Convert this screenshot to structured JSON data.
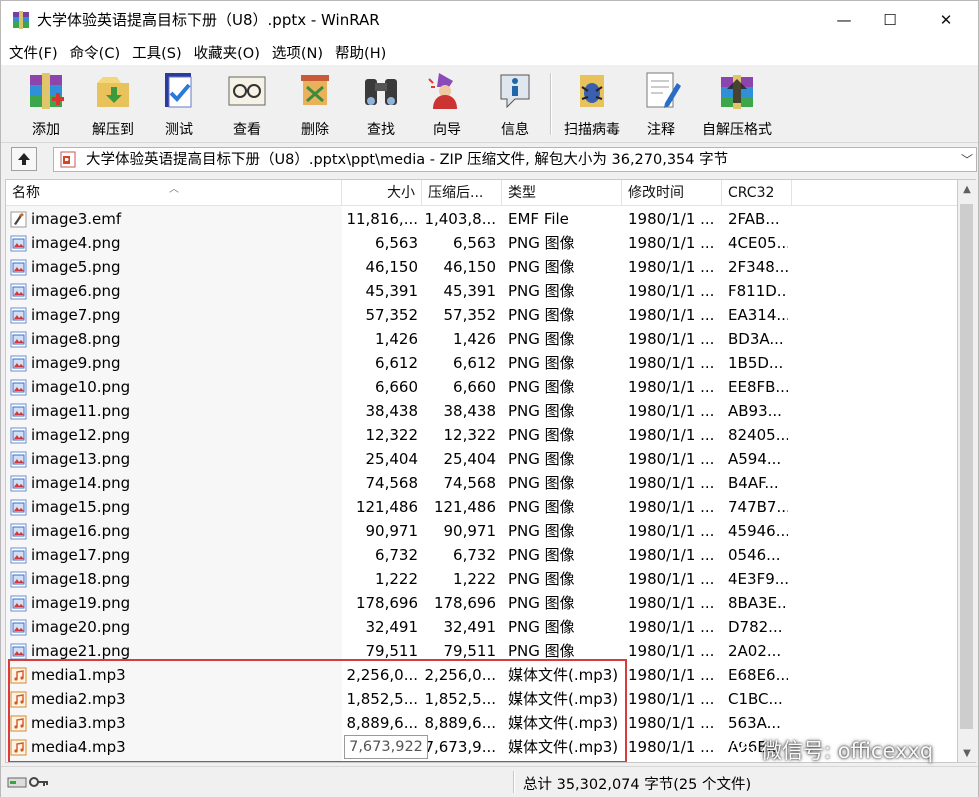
{
  "window": {
    "title": "大学体验英语提高目标下册（U8）.pptx - WinRAR",
    "controls": {
      "minimize": "—",
      "maximize": "☐",
      "close": "✕"
    }
  },
  "menu": [
    "文件(F)",
    "命令(C)",
    "工具(S)",
    "收藏夹(O)",
    "选项(N)",
    "帮助(H)"
  ],
  "toolbar": [
    {
      "label": "添加",
      "icon": "add-archive-icon"
    },
    {
      "label": "解压到",
      "icon": "extract-to-icon"
    },
    {
      "label": "测试",
      "icon": "test-icon"
    },
    {
      "label": "查看",
      "icon": "view-icon"
    },
    {
      "label": "删除",
      "icon": "delete-icon"
    },
    {
      "label": "查找",
      "icon": "find-icon"
    },
    {
      "label": "向导",
      "icon": "wizard-icon"
    },
    {
      "label": "信息",
      "icon": "info-icon"
    },
    {
      "label": "扫描病毒",
      "icon": "virus-scan-icon"
    },
    {
      "label": "注释",
      "icon": "comment-icon"
    },
    {
      "label": "自解压格式",
      "icon": "sfx-icon"
    }
  ],
  "address": {
    "path": "大学体验英语提高目标下册（U8）.pptx\\ppt\\media - ZIP 压缩文件, 解包大小为 36,270,354 字节"
  },
  "columns": {
    "name": "名称",
    "size": "大小",
    "packed": "压缩后...",
    "type": "类型",
    "modified": "修改时间",
    "crc": "CRC32"
  },
  "files": [
    {
      "name": "image3.emf",
      "size": "11,816,...",
      "packed": "1,403,8...",
      "type": "EMF File",
      "modified": "1980/1/1 ...",
      "crc": "2FAB...",
      "icon": "emf"
    },
    {
      "name": "image4.png",
      "size": "6,563",
      "packed": "6,563",
      "type": "PNG 图像",
      "modified": "1980/1/1 ...",
      "crc": "4CE05...",
      "icon": "png"
    },
    {
      "name": "image5.png",
      "size": "46,150",
      "packed": "46,150",
      "type": "PNG 图像",
      "modified": "1980/1/1 ...",
      "crc": "2F348...",
      "icon": "png"
    },
    {
      "name": "image6.png",
      "size": "45,391",
      "packed": "45,391",
      "type": "PNG 图像",
      "modified": "1980/1/1 ...",
      "crc": "F811D...",
      "icon": "png"
    },
    {
      "name": "image7.png",
      "size": "57,352",
      "packed": "57,352",
      "type": "PNG 图像",
      "modified": "1980/1/1 ...",
      "crc": "EA314...",
      "icon": "png"
    },
    {
      "name": "image8.png",
      "size": "1,426",
      "packed": "1,426",
      "type": "PNG 图像",
      "modified": "1980/1/1 ...",
      "crc": "BD3A...",
      "icon": "png"
    },
    {
      "name": "image9.png",
      "size": "6,612",
      "packed": "6,612",
      "type": "PNG 图像",
      "modified": "1980/1/1 ...",
      "crc": "1B5D...",
      "icon": "png"
    },
    {
      "name": "image10.png",
      "size": "6,660",
      "packed": "6,660",
      "type": "PNG 图像",
      "modified": "1980/1/1 ...",
      "crc": "EE8FB...",
      "icon": "png"
    },
    {
      "name": "image11.png",
      "size": "38,438",
      "packed": "38,438",
      "type": "PNG 图像",
      "modified": "1980/1/1 ...",
      "crc": "AB93...",
      "icon": "png"
    },
    {
      "name": "image12.png",
      "size": "12,322",
      "packed": "12,322",
      "type": "PNG 图像",
      "modified": "1980/1/1 ...",
      "crc": "82405...",
      "icon": "png"
    },
    {
      "name": "image13.png",
      "size": "25,404",
      "packed": "25,404",
      "type": "PNG 图像",
      "modified": "1980/1/1 ...",
      "crc": "A594...",
      "icon": "png"
    },
    {
      "name": "image14.png",
      "size": "74,568",
      "packed": "74,568",
      "type": "PNG 图像",
      "modified": "1980/1/1 ...",
      "crc": "B4AF...",
      "icon": "png"
    },
    {
      "name": "image15.png",
      "size": "121,486",
      "packed": "121,486",
      "type": "PNG 图像",
      "modified": "1980/1/1 ...",
      "crc": "747B7...",
      "icon": "png"
    },
    {
      "name": "image16.png",
      "size": "90,971",
      "packed": "90,971",
      "type": "PNG 图像",
      "modified": "1980/1/1 ...",
      "crc": "45946...",
      "icon": "png"
    },
    {
      "name": "image17.png",
      "size": "6,732",
      "packed": "6,732",
      "type": "PNG 图像",
      "modified": "1980/1/1 ...",
      "crc": "0546...",
      "icon": "png"
    },
    {
      "name": "image18.png",
      "size": "1,222",
      "packed": "1,222",
      "type": "PNG 图像",
      "modified": "1980/1/1 ...",
      "crc": "4E3F9...",
      "icon": "png"
    },
    {
      "name": "image19.png",
      "size": "178,696",
      "packed": "178,696",
      "type": "PNG 图像",
      "modified": "1980/1/1 ...",
      "crc": "8BA3E...",
      "icon": "png"
    },
    {
      "name": "image20.png",
      "size": "32,491",
      "packed": "32,491",
      "type": "PNG 图像",
      "modified": "1980/1/1 ...",
      "crc": "D782...",
      "icon": "png"
    },
    {
      "name": "image21.png",
      "size": "79,511",
      "packed": "79,511",
      "type": "PNG 图像",
      "modified": "1980/1/1 ...",
      "crc": "2A02...",
      "icon": "png"
    },
    {
      "name": "media1.mp3",
      "size": "2,256,0...",
      "packed": "2,256,0...",
      "type": "媒体文件(.mp3)",
      "modified": "1980/1/1 ...",
      "crc": "E68E6...",
      "icon": "mp3"
    },
    {
      "name": "media2.mp3",
      "size": "1,852,5...",
      "packed": "1,852,5...",
      "type": "媒体文件(.mp3)",
      "modified": "1980/1/1 ...",
      "crc": "C1BC...",
      "icon": "mp3"
    },
    {
      "name": "media3.mp3",
      "size": "8,889,6...",
      "packed": "8,889,6...",
      "type": "媒体文件(.mp3)",
      "modified": "1980/1/1 ...",
      "crc": "563A...",
      "icon": "mp3"
    },
    {
      "name": "media4.mp3",
      "size": "",
      "packed": "7,673,9...",
      "type": "媒体文件(.mp3)",
      "modified": "1980/1/1 ...",
      "crc": "A96E...",
      "icon": "mp3"
    }
  ],
  "tooltip": "7,673,922",
  "status": {
    "total": "总计 35,302,074 字节(25 个文件)"
  },
  "watermark": {
    "text": "微信号: officexxq",
    "icon": "wechat-icon"
  },
  "colors": {
    "highlight_border": "#d83b3b",
    "selection": "#ffffff"
  }
}
